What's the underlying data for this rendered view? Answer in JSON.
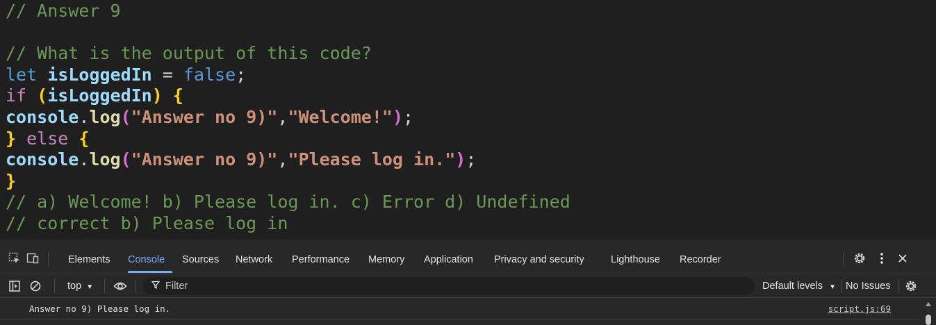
{
  "editor": {
    "lines": [
      [
        {
          "t": "// Answer 9",
          "c": "comment"
        }
      ],
      [],
      [
        {
          "t": "// What is the output of this code?",
          "c": "comment"
        }
      ],
      [
        {
          "t": "let ",
          "c": "keyword"
        },
        {
          "t": "isLoggedIn",
          "c": "var"
        },
        {
          "t": " = ",
          "c": "op"
        },
        {
          "t": "false",
          "c": "bool"
        },
        {
          "t": ";",
          "c": "punct"
        }
      ],
      [
        {
          "t": "if ",
          "c": "control"
        },
        {
          "t": "(",
          "c": "paren"
        },
        {
          "t": "isLoggedIn",
          "c": "var"
        },
        {
          "t": ")",
          "c": "paren"
        },
        {
          "t": " ",
          "c": "op"
        },
        {
          "t": "{",
          "c": "brace"
        }
      ],
      [
        {
          "t": "console",
          "c": "obj"
        },
        {
          "t": ".",
          "c": "punct"
        },
        {
          "t": "log",
          "c": "fn"
        },
        {
          "t": "(",
          "c": "bracket2"
        },
        {
          "t": "\"Answer no 9)\"",
          "c": "string"
        },
        {
          "t": ",",
          "c": "punct"
        },
        {
          "t": "\"Welcome!\"",
          "c": "string"
        },
        {
          "t": ")",
          "c": "bracket2"
        },
        {
          "t": ";",
          "c": "punct"
        }
      ],
      [
        {
          "t": "}",
          "c": "brace"
        },
        {
          "t": " else ",
          "c": "control"
        },
        {
          "t": "{",
          "c": "brace"
        }
      ],
      [
        {
          "t": "console",
          "c": "obj"
        },
        {
          "t": ".",
          "c": "punct"
        },
        {
          "t": "log",
          "c": "fn"
        },
        {
          "t": "(",
          "c": "bracket2"
        },
        {
          "t": "\"Answer no 9)\"",
          "c": "string"
        },
        {
          "t": ",",
          "c": "punct"
        },
        {
          "t": "\"Please log in.\"",
          "c": "string"
        },
        {
          "t": ")",
          "c": "bracket2"
        },
        {
          "t": ";",
          "c": "punct"
        }
      ],
      [
        {
          "t": "}",
          "c": "brace"
        }
      ],
      [
        {
          "t": "// a) Welcome! b) Please log in. c) Error d) Undefined",
          "c": "comment"
        }
      ],
      [
        {
          "t": "// correct b) Please log in",
          "c": "comment"
        }
      ]
    ]
  },
  "devtools": {
    "tabs": [
      {
        "label": "Elements"
      },
      {
        "label": "Console",
        "active": true
      },
      {
        "label": "Sources"
      },
      {
        "label": "Network"
      },
      {
        "label": "Performance"
      },
      {
        "label": "Memory"
      },
      {
        "label": "Application"
      },
      {
        "label": "Privacy and security"
      },
      {
        "label": "Lighthouse"
      },
      {
        "label": "Recorder"
      }
    ],
    "icons": {
      "inspect": "inspect-element-icon",
      "device": "device-toolbar-icon",
      "settings": "gear-icon",
      "more": "more-vertical-icon",
      "close": "close-icon",
      "sidebar": "sidebar-toggle-icon",
      "clear": "clear-console-icon",
      "eye": "eye-icon",
      "filter": "filter-icon",
      "console_settings": "gear-icon"
    },
    "toolbar": {
      "context": "top",
      "filter_placeholder": "Filter",
      "levels": "Default levels",
      "issues": "No Issues"
    },
    "console": {
      "message": "Answer no 9) Please log in.",
      "source": "script.js:69"
    },
    "colors": {
      "accent": "#7cacf8",
      "panel": "#282828",
      "editor_bg": "#1f1f1f"
    }
  }
}
